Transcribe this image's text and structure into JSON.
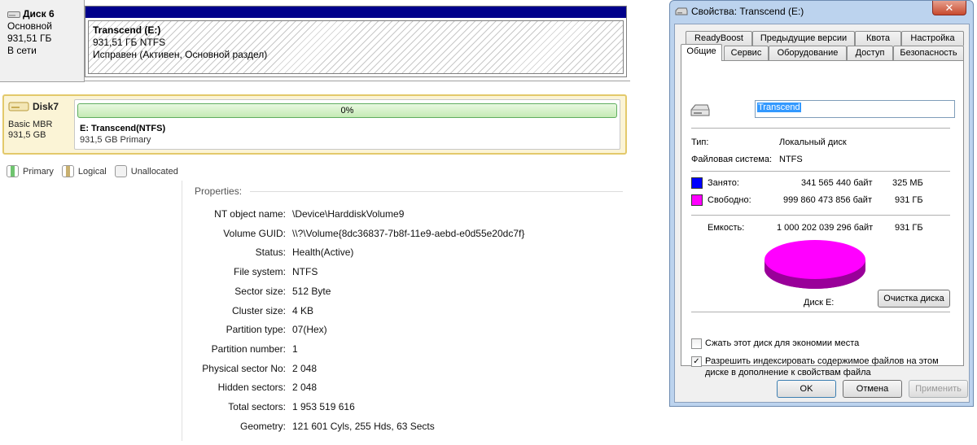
{
  "disk_management": {
    "disk_name": "Диск 6",
    "disk_type": "Основной",
    "disk_size": "931,51 ГБ",
    "disk_status": "В сети",
    "partition": {
      "title": "Transcend  (E:)",
      "size_fs": "931,51 ГБ NTFS",
      "status": "Исправен (Активен, Основной раздел)"
    }
  },
  "partition_tool": {
    "disk_name": "Disk7",
    "disk_type": "Basic MBR",
    "disk_size": "931,5 GB",
    "progress": "0%",
    "progress_value": 0,
    "partition_title": "E: Transcend(NTFS)",
    "partition_sub": "931,5 GB Primary",
    "legend": [
      {
        "label": "Primary",
        "color": "#6fc46f"
      },
      {
        "label": "Logical",
        "color": "#c8b070"
      },
      {
        "label": "Unallocated",
        "color": "#e8e8e8"
      }
    ],
    "properties_title": "Properties:",
    "properties": [
      {
        "key": "NT object name:",
        "value": "\\Device\\HarddiskVolume9"
      },
      {
        "key": "Volume GUID:",
        "value": "\\\\?\\Volume{8dc36837-7b8f-11e9-aebd-e0d55e20dc7f}"
      },
      {
        "key": "Status:",
        "value": "Health(Active)"
      },
      {
        "key": "File system:",
        "value": "NTFS"
      },
      {
        "key": "Sector size:",
        "value": "512 Byte"
      },
      {
        "key": "Cluster size:",
        "value": "4 KB"
      },
      {
        "key": "Partition type:",
        "value": "07(Hex)"
      },
      {
        "key": "Partition number:",
        "value": "1"
      },
      {
        "key": "Physical sector No:",
        "value": "2 048"
      },
      {
        "key": "Hidden sectors:",
        "value": "2 048"
      },
      {
        "key": "Total sectors:",
        "value": "1 953 519 616"
      },
      {
        "key": "Geometry:",
        "value": "121 601 Cyls, 255 Hds, 63 Sects"
      }
    ]
  },
  "dialog": {
    "title": "Свойства: Transcend (E:)",
    "close": "✕",
    "tabs_row1": [
      "ReadyBoost",
      "Предыдущие версии",
      "Квота",
      "Настройка"
    ],
    "tabs_row2": [
      "Общие",
      "Сервис",
      "Оборудование",
      "Доступ",
      "Безопасность"
    ],
    "volume_name": "Transcend",
    "type_label": "Тип:",
    "type_value": "Локальный диск",
    "fs_label": "Файловая система:",
    "fs_value": "NTFS",
    "used_label": "Занято:",
    "used_bytes": "341 565 440 байт",
    "used_short": "325 МБ",
    "used_color": "#0000ff",
    "free_label": "Свободно:",
    "free_bytes": "999 860 473 856 байт",
    "free_short": "931 ГБ",
    "free_color": "#ff00ff",
    "capacity_label": "Емкость:",
    "capacity_bytes": "1 000 202 039 296 байт",
    "capacity_short": "931 ГБ",
    "disk_label": "Диск E:",
    "cleanup_button": "Очистка диска",
    "compress_label": "Сжать этот диск для экономии места",
    "compress_checked": false,
    "index_label_1": "Разрешить индексировать содержимое файлов на этом",
    "index_label_2": "диске в дополнение к свойствам файла",
    "index_checked": true,
    "ok_button": "OK",
    "cancel_button": "Отмена",
    "apply_button": "Применить"
  }
}
